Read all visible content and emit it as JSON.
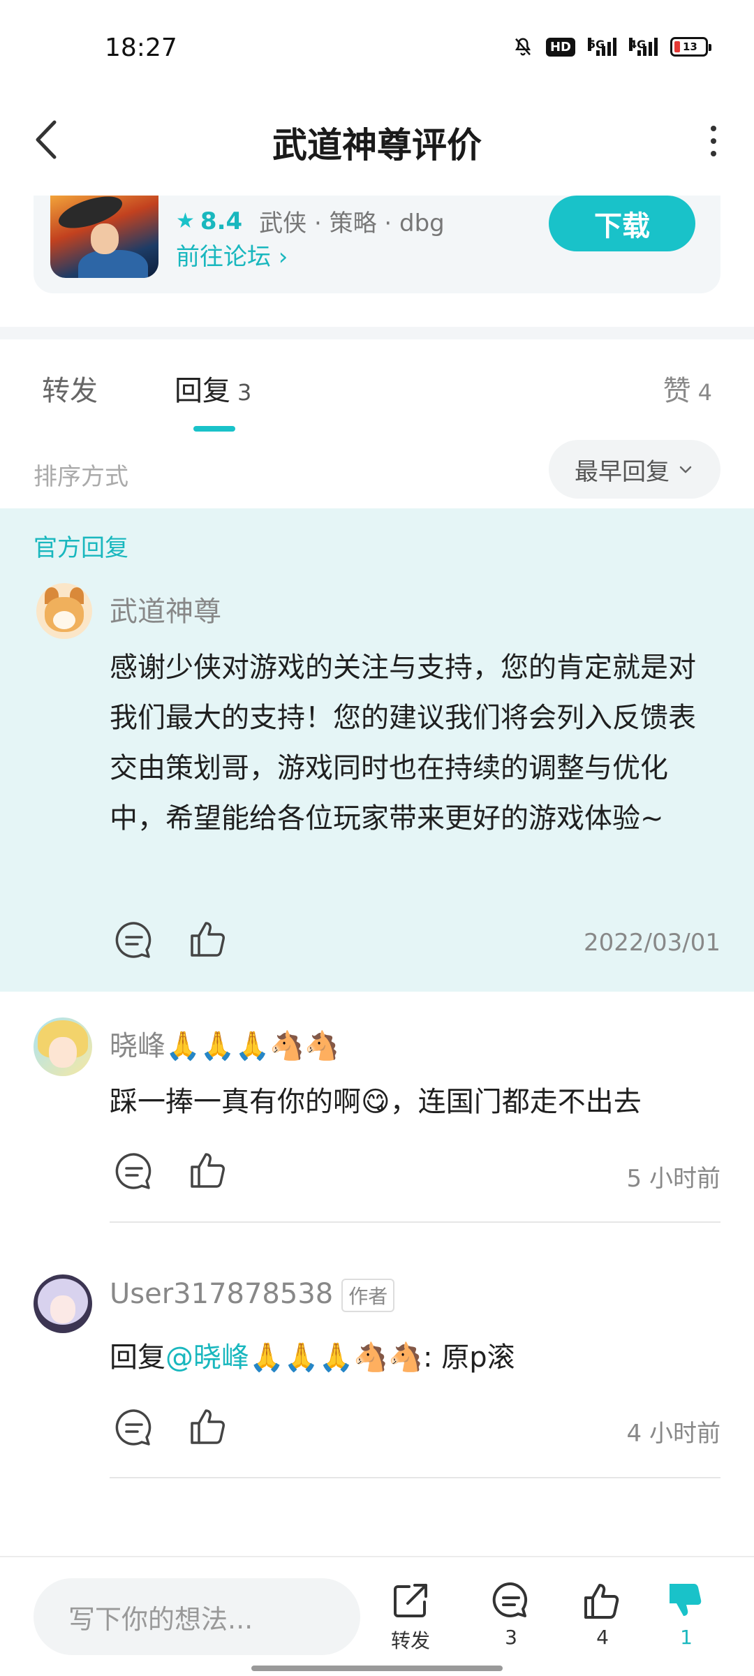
{
  "status_bar": {
    "time": "18:27",
    "hd": "HD",
    "net1": "5G",
    "net2": "4G",
    "battery": "13"
  },
  "header": {
    "title": "武道神尊评价"
  },
  "game": {
    "rating": "8.4",
    "tags": "武侠 · 策略 · dbg",
    "forum_link": "前往论坛 ›",
    "download_label": "下载"
  },
  "tabs": {
    "forward": "转发",
    "reply": "回复",
    "reply_count": "3",
    "like": "赞",
    "like_count": "4"
  },
  "sort": {
    "label": "排序方式",
    "value": "最早回复"
  },
  "official": {
    "section_label": "官方回复",
    "username": "武道神尊",
    "text": "感谢少侠对游戏的关注与支持，您的肯定就是对我们最大的支持！您的建议我们将会列入反馈表交由策划哥，游戏同时也在持续的调整与优化中，希望能给各位玩家带来更好的游戏体验~",
    "date": "2022/03/01"
  },
  "replies": [
    {
      "username": "晓峰🙏🙏🙏🐴🐴",
      "text": "踩一捧一真有你的啊😋，连国门都走不出去",
      "time": "5 小时前"
    },
    {
      "username": "User317878538",
      "badge": "作者",
      "prefix": "回复",
      "mention": "@晓峰🙏🙏🙏🐴🐴",
      "text": ": 原p滚",
      "time": "4 小时前"
    }
  ],
  "bottom_bar": {
    "input_placeholder": "写下你的想法...",
    "forward_label": "转发",
    "comment_count": "3",
    "like_count": "4",
    "dislike_count": "1"
  },
  "colors": {
    "accent": "#19c2c9",
    "official_bg": "#e5f5f6"
  }
}
